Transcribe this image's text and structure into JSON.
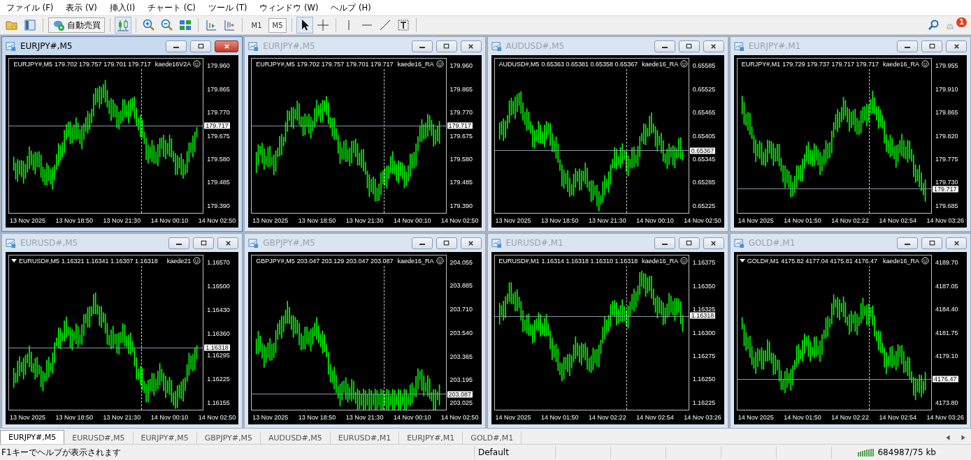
{
  "menu": [
    "ファイル (F)",
    "表示 (V)",
    "挿入(I)",
    "チャート (C)",
    "ツール (T)",
    "ウィンドウ (W)",
    "ヘルプ (H)"
  ],
  "toolbar": {
    "auto_trade": "自動売買",
    "timeframes": [
      {
        "label": "M1",
        "selected": false
      },
      {
        "label": "M5",
        "selected": true
      }
    ],
    "notification_count": "1"
  },
  "charts": [
    {
      "title": "EURJPY#,M5",
      "active": true,
      "symbol": "EURJPY#,M5",
      "ohlc": "179.702 179.757 179.701 179.717",
      "ea": "kaede16V2A",
      "price_ticks": [
        "179.960",
        "179.865",
        "179.770",
        "179.675",
        "179.580",
        "179.485",
        "179.390"
      ],
      "current_price": "179.717",
      "time_ticks": [
        "13 Nov 2025",
        "13 Nov 18:50",
        "13 Nov 21:30",
        "14 Nov 00:10",
        "14 Nov 02:50"
      ]
    },
    {
      "title": "EURJPY#,M5",
      "active": false,
      "symbol": "EURJPY#,M5",
      "ohlc": "179.702 179.757 179.701 179.717",
      "ea": "kaede16_RA",
      "price_ticks": [
        "179.960",
        "179.865",
        "179.770",
        "179.675",
        "179.580",
        "179.485",
        "179.390"
      ],
      "current_price": "179.717",
      "time_ticks": [
        "13 Nov 2025",
        "13 Nov 18:50",
        "13 Nov 21:30",
        "14 Nov 00:10",
        "14 Nov 02:50"
      ]
    },
    {
      "title": "AUDUSD#,M5",
      "active": false,
      "symbol": "AUDUSD#,M5",
      "ohlc": "0.65363 0.65381 0.65358 0.65367",
      "ea": "kaede16_RA",
      "price_ticks": [
        "0.65585",
        "0.65525",
        "0.65465",
        "0.65405",
        "0.65345",
        "0.65285",
        "0.65225"
      ],
      "current_price": "0.65367",
      "time_ticks": [
        "13 Nov 2025",
        "13 Nov 18:50",
        "13 Nov 21:30",
        "14 Nov 00:10",
        "14 Nov 02:50"
      ]
    },
    {
      "title": "EURJPY#,M1",
      "active": false,
      "symbol": "EURJPY#,M1",
      "ohlc": "179.729 179.737 179.717 179.717",
      "ea": "kaede16_RA",
      "price_ticks": [
        "179.955",
        "179.910",
        "179.865",
        "179.820",
        "179.775",
        "179.730",
        "179.685"
      ],
      "current_price": "179.717",
      "time_ticks": [
        "14 Nov 2025",
        "14 Nov 01:50",
        "14 Nov 02:22",
        "14 Nov 02:54",
        "14 Nov 03:26"
      ]
    },
    {
      "title": "EURUSD#,M5",
      "active": false,
      "symbol": "EURUSD#,M5",
      "ohlc": "1.16321 1.16341 1.16307 1.16318",
      "ea": "kaede21",
      "price_ticks": [
        "1.16570",
        "1.16500",
        "1.16430",
        "1.16360",
        "1.16295",
        "1.16225",
        "1.16155"
      ],
      "current_price": "1.16318",
      "time_ticks": [
        "13 Nov 2025",
        "13 Nov 18:50",
        "13 Nov 21:30",
        "14 Nov 00:10",
        "14 Nov 02:50"
      ]
    },
    {
      "title": "GBPJPY#,M5",
      "active": false,
      "symbol": "GBPJPY#,M5",
      "ohlc": "203.047 203.129 203.047 203.087",
      "ea": "kaede16_RA",
      "price_ticks": [
        "204.055",
        "203.885",
        "203.710",
        "203.540",
        "203.365",
        "203.195",
        "203.025"
      ],
      "current_price": "203.087",
      "time_ticks": [
        "13 Nov 2025",
        "13 Nov 18:50",
        "13 Nov 21:30",
        "14 Nov 00:10",
        "14 Nov 02:50"
      ]
    },
    {
      "title": "EURUSD#,M1",
      "active": false,
      "symbol": "EURUSD#,M1",
      "ohlc": "1.16314 1.16318 1.16310 1.16318",
      "ea": "kaede16_RA",
      "price_ticks": [
        "1.16375",
        "1.16350",
        "1.16325",
        "1.16300",
        "1.16275",
        "1.16250",
        "1.16225"
      ],
      "current_price": "1.16318",
      "time_ticks": [
        "14 Nov 2025",
        "14 Nov 01:50",
        "14 Nov 02:22",
        "14 Nov 02:54",
        "14 Nov 03:26"
      ]
    },
    {
      "title": "GOLD#,M1",
      "active": false,
      "symbol": "GOLD#,M1",
      "ohlc": "4175.82 4177.04 4175.81 4176.47",
      "ea": "kaede16_RA",
      "price_ticks": [
        "4189.70",
        "4187.05",
        "4184.40",
        "4181.75",
        "4179.10",
        "4173.80"
      ],
      "current_price": "4176.47",
      "time_ticks": [
        "14 Nov 2025",
        "14 Nov 01:50",
        "14 Nov 02:22",
        "14 Nov 02:54",
        "14 Nov 03:26"
      ]
    }
  ],
  "tabs": [
    {
      "label": "EURJPY#,M5",
      "selected": true
    },
    {
      "label": "EURUSD#,M5",
      "selected": false
    },
    {
      "label": "EURJPY#,M5",
      "selected": false
    },
    {
      "label": "GBPJPY#,M5",
      "selected": false
    },
    {
      "label": "AUDUSD#,M5",
      "selected": false
    },
    {
      "label": "EURUSD#,M1",
      "selected": false
    },
    {
      "label": "EURJPY#,M1",
      "selected": false
    },
    {
      "label": "GOLD#,M1",
      "selected": false
    }
  ],
  "status_bar": {
    "help": "F1キーでヘルプが表示されます",
    "profile": "Default",
    "traffic": "684987/75 kb"
  }
}
